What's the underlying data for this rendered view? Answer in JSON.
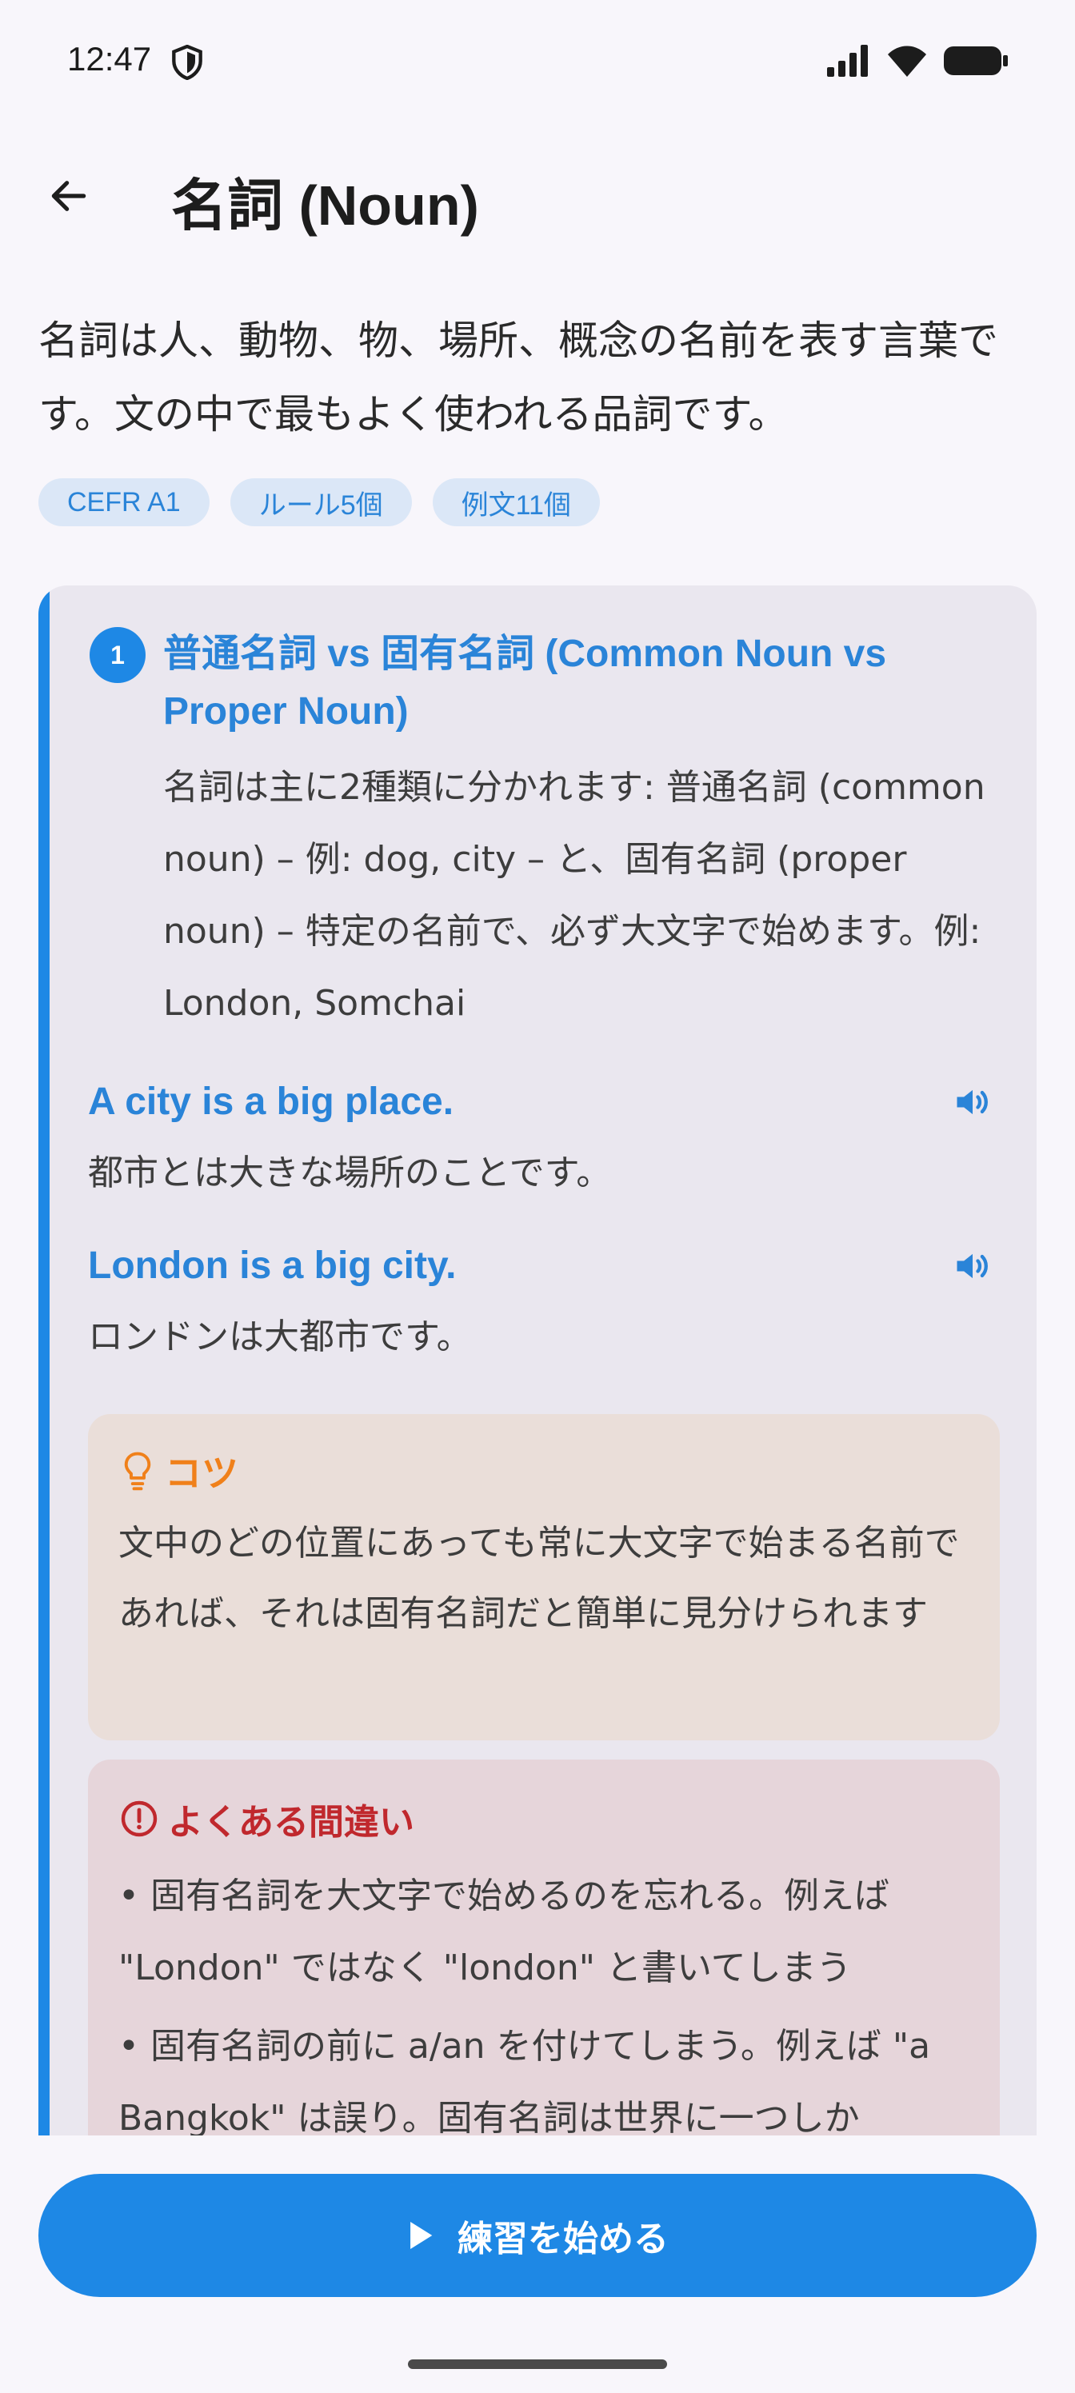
{
  "status_bar": {
    "time": "12:47"
  },
  "header": {
    "title": "名詞 (Noun)"
  },
  "description": "名詞は人、動物、物、場所、概念の名前を表す言葉です。文の中で最もよく使われる品詞です。",
  "chips": [
    "CEFR A1",
    "ルール5個",
    "例文11個"
  ],
  "rule": {
    "number": "1",
    "title": "普通名詞 vs 固有名詞 (Common Noun vs Proper Noun)",
    "body": "名詞は主に2種類に分かれます: 普通名詞 (common noun) – 例: dog, city – と、固有名詞 (proper noun) – 特定の名前で、必ず大文字で始めます。例: London, Somchai",
    "examples": [
      {
        "en": "A city is a big place.",
        "ja": "都市とは大きな場所のことです。"
      },
      {
        "en": "London is a big city.",
        "ja": "ロンドンは大都市です。"
      }
    ],
    "tip": {
      "title": "コツ",
      "text": "文中のどの位置にあっても常に大文字で始まる名前であれば、それは固有名詞だと簡単に見分けられます"
    },
    "mistakes": {
      "title": "よくある間違い",
      "items": [
        "• 固有名詞を大文字で始めるのを忘れる。例えば \"London\" ではなく \"london\" と書いてしまう",
        "• 固有名詞の前に a/an を付けてしまう。例えば \"a Bangkok\" は誤り。固有名詞は世界に一つしか"
      ]
    }
  },
  "start_button": {
    "label": "練習を始める"
  },
  "colors": {
    "accent": "#1e88e5",
    "tip": "#f0801a",
    "mistake": "#c0282d"
  }
}
